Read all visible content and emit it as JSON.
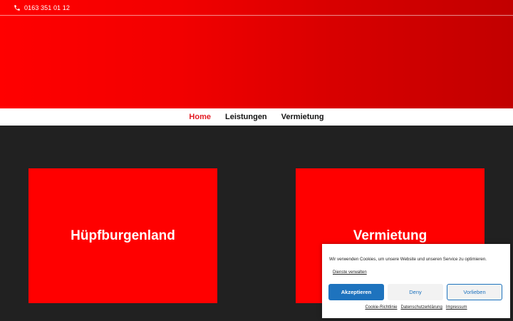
{
  "topbar": {
    "phone_icon": "phone-icon",
    "phone_number": "0163 351 01 12"
  },
  "nav": {
    "items": [
      {
        "label": "Home",
        "active": true
      },
      {
        "label": "Leistungen",
        "active": false
      },
      {
        "label": "Vermietung",
        "active": false
      }
    ]
  },
  "cards": [
    {
      "title": "Hüpfburgenland"
    },
    {
      "title": "Vermietung"
    }
  ],
  "cookie_banner": {
    "text": "Wir verwenden Cookies, um unsere Website und unseren Service zu optimieren.",
    "manage_link": "Dienste verwalten",
    "accept_label": "Akzeptieren",
    "deny_label": "Deny",
    "preferences_label": "Vorlieben",
    "links": [
      "Cookie-Richtlinie",
      "Datenschutzerklärung",
      "Impressum"
    ]
  },
  "colors": {
    "accent_red": "#ff0000",
    "nav_active": "#e31b23",
    "dark_bg": "#212121",
    "cookie_blue": "#1e73be"
  }
}
